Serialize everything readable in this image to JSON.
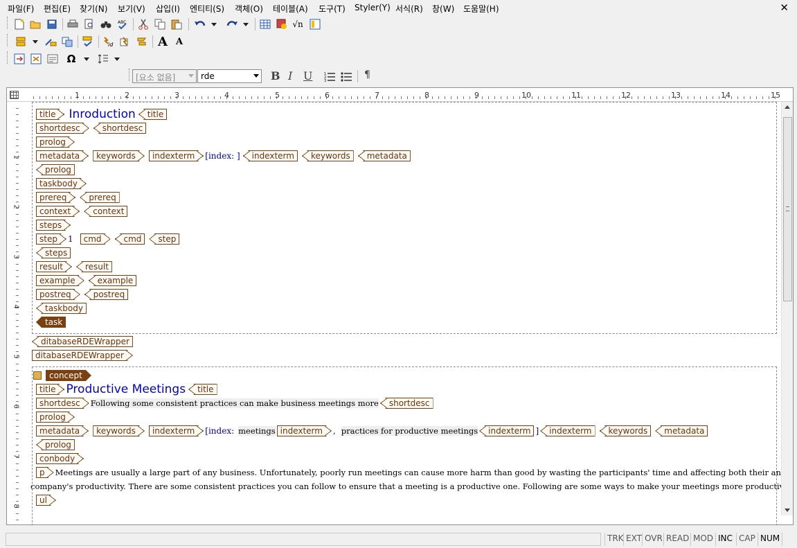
{
  "menubar": {
    "items": [
      "파일(F)",
      "편집(E)",
      "찾기(N)",
      "보기(V)",
      "삽입(I)",
      "엔티티(S)",
      "객체(O)",
      "테이블(A)",
      "도구(T)",
      "Styler(Y)",
      "서식(R)",
      "창(W)",
      "도움말(H)"
    ],
    "close_glyph": "✕"
  },
  "toolbar": {
    "element_combo": "[요소 없음]",
    "style_combo": "rde",
    "bold": "B",
    "italic": "I",
    "underline": "U",
    "pilcrow": "¶",
    "font_up": "A",
    "font_down": "A",
    "omega": "Ω",
    "sqrt": "√n"
  },
  "ruler": {
    "numbers": [
      "1",
      "2",
      "3",
      "4",
      "5",
      "6",
      "7",
      "8",
      "9",
      "10",
      "11",
      "12",
      "13",
      "14",
      "15"
    ],
    "v_numbers": [
      "1",
      "2",
      "3",
      "4",
      "5",
      "6",
      "7",
      "8"
    ]
  },
  "doc1": {
    "title_tag": "title",
    "title_text": "Inroduction",
    "title_end": "title",
    "shortdesc": "shortdesc",
    "shortdesc_end": "shortdesc",
    "prolog": "prolog",
    "metadata": "metadata",
    "keywords": "keywords",
    "indexterm": "indexterm",
    "index_text": "[index: ]",
    "indexterm_end": "indexterm",
    "keywords_end": "keywords",
    "metadata_end": "metadata",
    "prolog_end": "prolog",
    "taskbody": "taskbody",
    "prereq": "prereq",
    "prereq_end": "prereq",
    "context": "context",
    "context_end": "context",
    "steps": "steps",
    "step": "step",
    "step_num": "1",
    "cmd": "cmd",
    "cmd_end": "cmd",
    "step_end": "step",
    "steps_end": "steps",
    "result": "result",
    "result_end": "result",
    "example": "example",
    "example_end": "example",
    "postreq": "postreq",
    "postreq_end": "postreq",
    "taskbody_end": "taskbody",
    "task_end": "task"
  },
  "wrapper": {
    "end1": "ditabaseRDEWrapper",
    "start2": "ditabaseRDEWrapper"
  },
  "doc2": {
    "concept": "concept",
    "title_tag": "title",
    "title_text": "Productive Meetings",
    "title_end": "title",
    "shortdesc": "shortdesc",
    "shortdesc_text": "Following some consistent practices can make business meetings more",
    "shortdesc_end": "shortdesc",
    "prolog": "prolog",
    "metadata": "metadata",
    "keywords": "keywords",
    "indexterm": "indexterm",
    "index_label": "[index:",
    "index_meetings": "meetings",
    "indexterm_inner": "indexterm",
    "index_comma": ",",
    "index_practices": "practices for productive meetings",
    "indexterm_inner_end": "indexterm",
    "index_close": "]",
    "indexterm_end": "indexterm",
    "keywords_end": "keywords",
    "metadata_end": "metadata",
    "prolog_end": "prolog",
    "conbody": "conbody",
    "p": "p",
    "para_line1": "Meetings are usually a large part of any business. Unfortunately, poorly run meetings can cause more harm than good by wasting the participants' time and affecting both their and the",
    "para_line2": "company's productivity. There are some consistent practices you can follow to ensure that a meeting is a productive one. Following are some ways to make your meetings more productive:",
    "p_end": "p",
    "ul": "ul"
  },
  "statusbar": {
    "indicators": [
      "TRK",
      "EXT",
      "OVR",
      "READ",
      "MOD",
      "INC",
      "CAP",
      "NUM"
    ]
  }
}
